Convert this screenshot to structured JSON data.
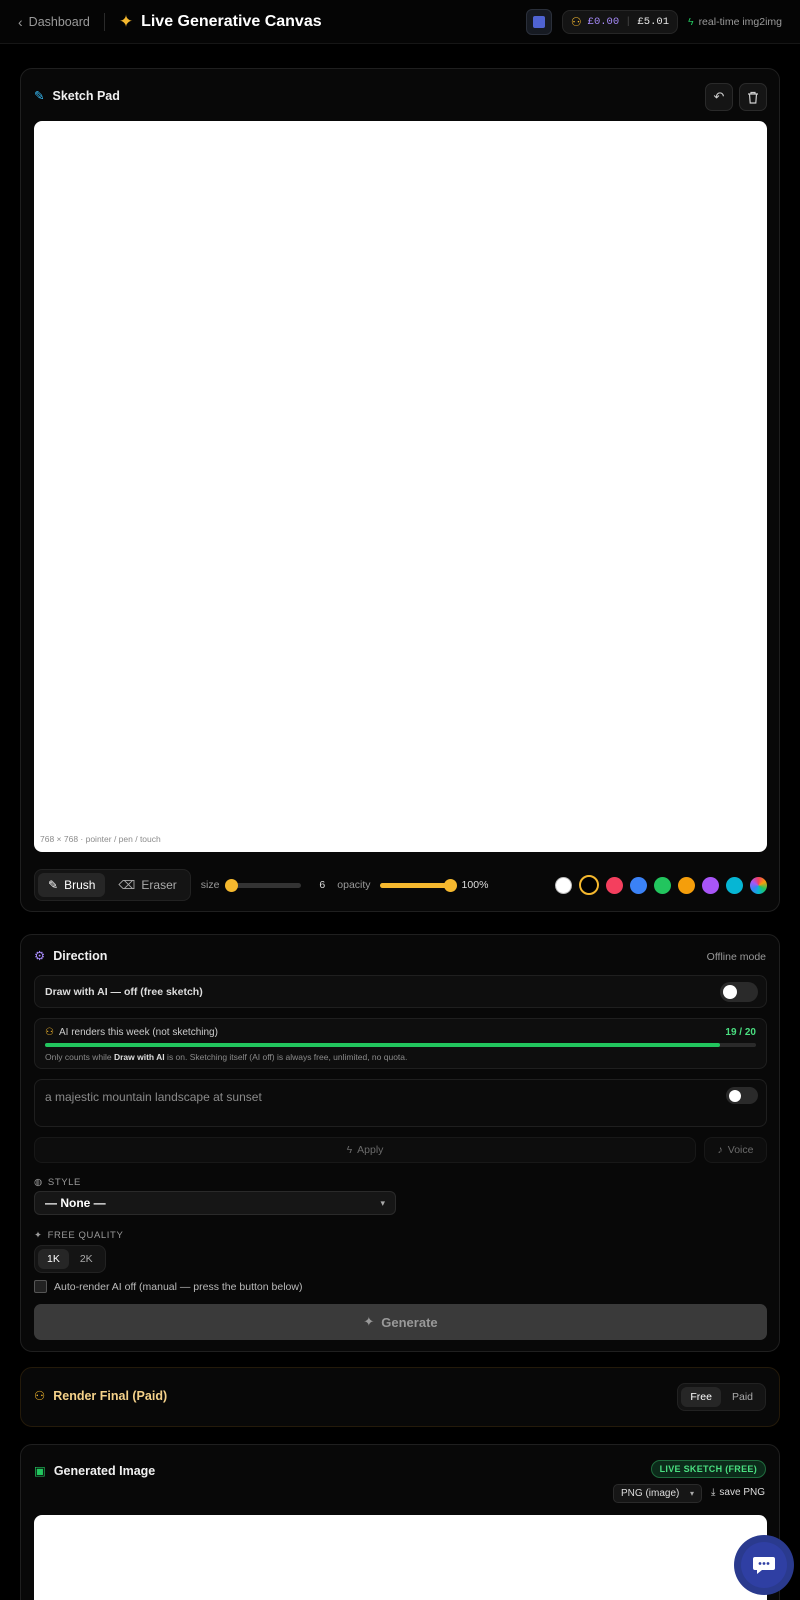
{
  "topbar": {
    "back_label": "Dashboard",
    "title": "Live Generative Canvas",
    "credit_left": "£0.00",
    "credit_right": "£5.01",
    "mode_label": "real-time img2img"
  },
  "sketch_pad": {
    "title": "Sketch Pad",
    "canvas_hint": "768 × 768 · pointer / pen / touch",
    "tools": {
      "brush": "Brush",
      "eraser": "Eraser"
    },
    "size_label": "size",
    "size_value": "6",
    "size_fraction": 0.05,
    "opacity_label": "opacity",
    "opacity_value": "100%",
    "opacity_fraction": 1.0,
    "swatches": [
      "#ffffff",
      "#000000",
      "#f43f5e",
      "#3b82f6",
      "#22c55e",
      "#f59e0b",
      "#a855f7",
      "#06b6d4",
      "rainbow"
    ],
    "selected_swatch": 1
  },
  "direction": {
    "title": "Direction",
    "status": "Offline mode",
    "draw_ai_label": "Draw with AI — off (free sketch)",
    "renders_label": "AI renders this week (not sketching)",
    "renders_count": "19 / 20",
    "renders_fraction": 0.95,
    "renders_note_prefix": "Only counts while ",
    "renders_note_bold": "Draw with AI",
    "renders_note_suffix": " is on. Sketching itself (AI off) is always free, unlimited, no quota.",
    "prompt_placeholder": "a majestic mountain landscape at sunset",
    "apply_label": "Apply",
    "voice_label": "Voice",
    "style_label": "STYLE",
    "style_value": "— None —",
    "quality_label": "FREE QUALITY",
    "quality_options": [
      "1K",
      "2K"
    ],
    "autorender_label": "Auto-render AI off (manual — press the button below)",
    "generate_label": "Generate"
  },
  "render_final": {
    "title": "Render Final (Paid)",
    "options": [
      "Free",
      "Paid"
    ]
  },
  "generated": {
    "title": "Generated Image",
    "badge": "LIVE SKETCH (FREE)",
    "format_value": "PNG (image)",
    "save_label": "save PNG"
  }
}
